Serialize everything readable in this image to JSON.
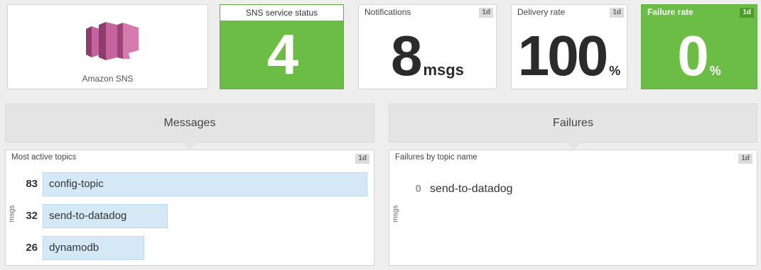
{
  "logo": {
    "caption": "Amazon SNS",
    "icon": "amazon-sns-logo"
  },
  "status": {
    "title": "SNS service status",
    "value": "4"
  },
  "notifications": {
    "title": "Notifications",
    "badge": "1d",
    "value": "8",
    "unit": "msgs"
  },
  "delivery": {
    "title": "Delivery rate",
    "badge": "1d",
    "value": "100",
    "unit": "%"
  },
  "failure": {
    "title": "Failure rate",
    "badge": "1d",
    "value": "0",
    "unit": "%"
  },
  "messages": {
    "header": "Messages",
    "panel_title": "Most active topics",
    "badge": "1d",
    "ylabel": "msgs",
    "rows": [
      {
        "value": "83",
        "label": "config-topic",
        "fraction": 1.0
      },
      {
        "value": "32",
        "label": "send-to-datadog",
        "fraction": 0.385
      },
      {
        "value": "26",
        "label": "dynamodb",
        "fraction": 0.313
      }
    ]
  },
  "failures": {
    "header": "Failures",
    "panel_title": "Failures by topic name",
    "badge": "1d",
    "ylabel": "msgs",
    "rows": [
      {
        "value": "0",
        "label": "send-to-datadog"
      }
    ]
  },
  "colors": {
    "green": "#6cbd45",
    "bar": "#d4e8f5",
    "sns_pink": "#c6639f"
  }
}
